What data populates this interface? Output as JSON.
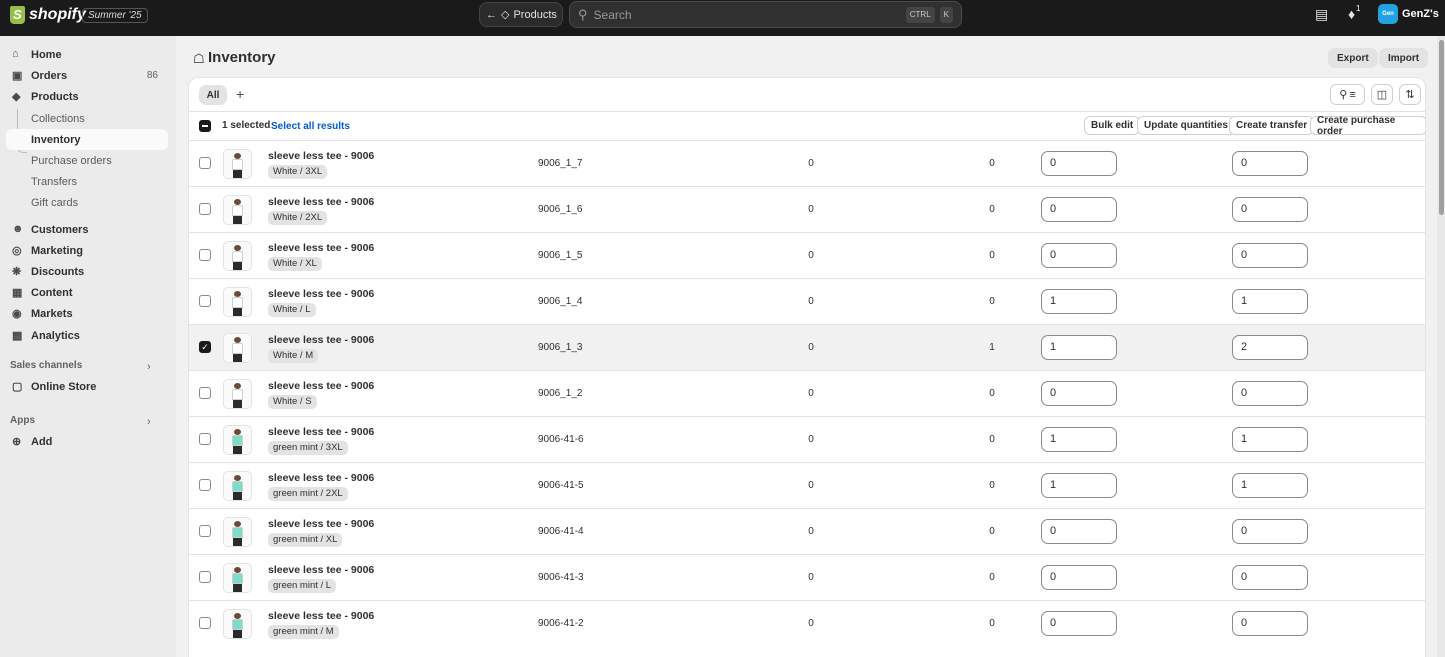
{
  "topbar": {
    "logo_text": "shopify",
    "edition": "Summer '25",
    "back_label": "Products",
    "search_placeholder": "Search",
    "shortcut_ctrl": "CTRL",
    "shortcut_key": "K",
    "notification_count": "1",
    "avatar_initials": "Gen",
    "store_name": "GenZ's"
  },
  "sidebar": {
    "items": [
      {
        "label": "Home",
        "icon": "home-icon"
      },
      {
        "label": "Orders",
        "icon": "orders-icon",
        "count": "86"
      },
      {
        "label": "Products",
        "icon": "tag-icon"
      },
      {
        "label": "Collections"
      },
      {
        "label": "Inventory",
        "active": true
      },
      {
        "label": "Purchase orders"
      },
      {
        "label": "Transfers"
      },
      {
        "label": "Gift cards"
      },
      {
        "label": "Customers",
        "icon": "person-icon"
      },
      {
        "label": "Marketing",
        "icon": "target-icon"
      },
      {
        "label": "Discounts",
        "icon": "discount-icon"
      },
      {
        "label": "Content",
        "icon": "content-icon"
      },
      {
        "label": "Markets",
        "icon": "globe-icon"
      },
      {
        "label": "Analytics",
        "icon": "chart-icon"
      }
    ],
    "sales_channels_label": "Sales channels",
    "online_store_label": "Online Store",
    "apps_label": "Apps",
    "add_label": "Add"
  },
  "page": {
    "title": "Inventory",
    "export_label": "Export",
    "import_label": "Import"
  },
  "tabs": {
    "all_label": "All",
    "add_label": "+"
  },
  "bulk": {
    "selected_text": "1 selected",
    "select_all_label": "Select all results",
    "bulk_edit_label": "Bulk edit",
    "update_quantities_label": "Update quantities",
    "create_transfer_label": "Create transfer",
    "create_po_label": "Create purchase order"
  },
  "rows": [
    {
      "name": "sleeve less tee - 9006",
      "variant": "White / 3XL",
      "sku": "9006_1_7",
      "unavailable": "0",
      "committed": "0",
      "available": "0",
      "on_hand": "0",
      "selected": false,
      "color": "#ffffff"
    },
    {
      "name": "sleeve less tee - 9006",
      "variant": "White / 2XL",
      "sku": "9006_1_6",
      "unavailable": "0",
      "committed": "0",
      "available": "0",
      "on_hand": "0",
      "selected": false,
      "color": "#ffffff"
    },
    {
      "name": "sleeve less tee - 9006",
      "variant": "White / XL",
      "sku": "9006_1_5",
      "unavailable": "0",
      "committed": "0",
      "available": "0",
      "on_hand": "0",
      "selected": false,
      "color": "#ffffff"
    },
    {
      "name": "sleeve less tee - 9006",
      "variant": "White / L",
      "sku": "9006_1_4",
      "unavailable": "0",
      "committed": "0",
      "available": "1",
      "on_hand": "1",
      "selected": false,
      "color": "#ffffff"
    },
    {
      "name": "sleeve less tee - 9006",
      "variant": "White / M",
      "sku": "9006_1_3",
      "unavailable": "0",
      "committed": "1",
      "available": "1",
      "on_hand": "2",
      "selected": true,
      "color": "#ffffff"
    },
    {
      "name": "sleeve less tee - 9006",
      "variant": "White / S",
      "sku": "9006_1_2",
      "unavailable": "0",
      "committed": "0",
      "available": "0",
      "on_hand": "0",
      "selected": false,
      "color": "#ffffff"
    },
    {
      "name": "sleeve less tee - 9006",
      "variant": "green mint / 3XL",
      "sku": "9006-41-6",
      "unavailable": "0",
      "committed": "0",
      "available": "1",
      "on_hand": "1",
      "selected": false,
      "color": "#7fdcc8"
    },
    {
      "name": "sleeve less tee - 9006",
      "variant": "green mint / 2XL",
      "sku": "9006-41-5",
      "unavailable": "0",
      "committed": "0",
      "available": "1",
      "on_hand": "1",
      "selected": false,
      "color": "#7fdcc8"
    },
    {
      "name": "sleeve less tee - 9006",
      "variant": "green mint / XL",
      "sku": "9006-41-4",
      "unavailable": "0",
      "committed": "0",
      "available": "0",
      "on_hand": "0",
      "selected": false,
      "color": "#7fdcc8"
    },
    {
      "name": "sleeve less tee - 9006",
      "variant": "green mint / L",
      "sku": "9006-41-3",
      "unavailable": "0",
      "committed": "0",
      "available": "0",
      "on_hand": "0",
      "selected": false,
      "color": "#7fdcc8"
    },
    {
      "name": "sleeve less tee - 9006",
      "variant": "green mint / M",
      "sku": "9006-41-2",
      "unavailable": "0",
      "committed": "0",
      "available": "0",
      "on_hand": "0",
      "selected": false,
      "color": "#7fdcc8"
    }
  ]
}
